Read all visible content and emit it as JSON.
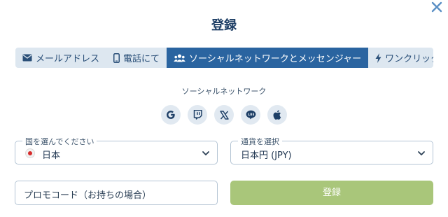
{
  "title": "登録",
  "tabs": [
    {
      "label": "メールアドレス",
      "icon": "envelope-icon",
      "active": false
    },
    {
      "label": "電話にて",
      "icon": "phone-icon",
      "active": false
    },
    {
      "label": "ソーシャルネットワークとメッセンジャー",
      "icon": "users-icon",
      "active": true
    },
    {
      "label": "ワンクリック",
      "icon": "lightning-icon",
      "active": false
    }
  ],
  "social": {
    "heading": "ソーシャルネットワーク",
    "buttons": [
      "google-icon",
      "twitch-icon",
      "x-icon",
      "line-icon",
      "apple-icon"
    ]
  },
  "country": {
    "legend": "国を選んでください",
    "value": "日本",
    "flag": "japan-flag-icon"
  },
  "currency": {
    "legend": "通貨を選択",
    "value": "日本円 (JPY)"
  },
  "promo": {
    "placeholder": "プロモコード（お持ちの場合）"
  },
  "register_button": {
    "label": "登録"
  },
  "colors": {
    "accent": "#2a64a0",
    "tab_bg": "#dde7f0",
    "register_bg": "#a9c67a",
    "close": "#5a8fc4"
  }
}
